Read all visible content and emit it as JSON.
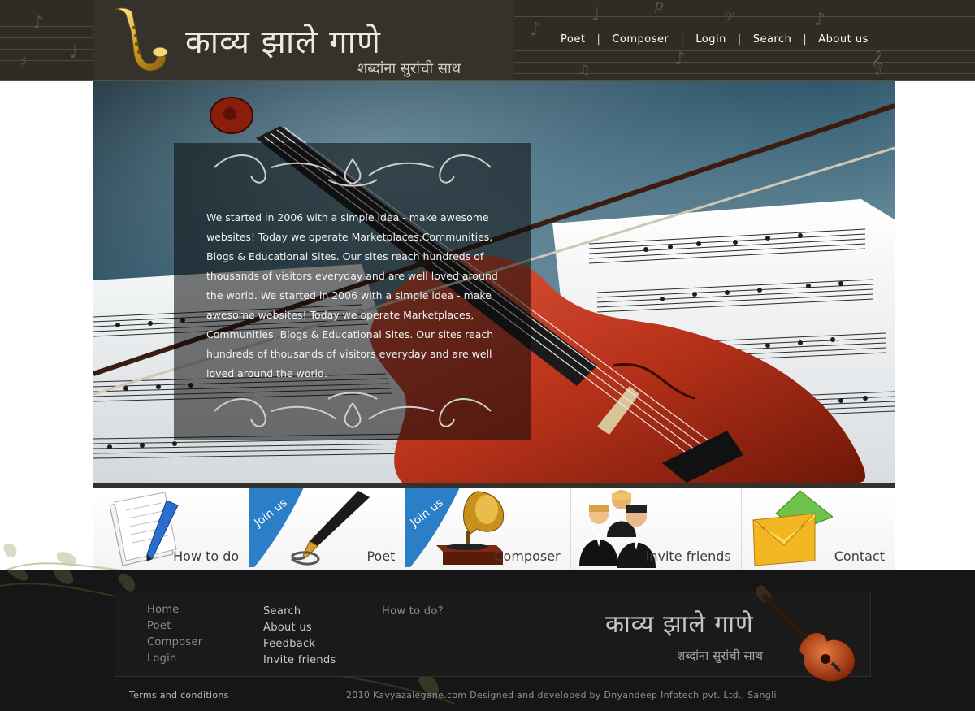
{
  "header": {
    "logo_title": "काव्य झाले गाणे",
    "logo_tagline": "शब्दांना सुरांची साथ",
    "nav": [
      "Poet",
      "Composer",
      "Login",
      "Search",
      "About us"
    ],
    "nav_separator": "|"
  },
  "banner": {
    "text": "We started in 2006 with a simple idea - make awesome websites! Today we operate Marketplaces,Communities, Blogs & Educational Sites.  Our sites reach hundreds of thousands of visitors everyday and are well loved around the world. We started in 2006 with a simple idea - make awesome websites! Today we operate Marketplaces, Communities, Blogs & Educational Sites.  Our sites reach hundreds of thousands of visitors everyday and are well loved around the world."
  },
  "features": {
    "join_badge": "Join us",
    "items": [
      {
        "label": "How to do",
        "icon": "document-pen-icon",
        "join": false
      },
      {
        "label": "Poet",
        "icon": "fountain-pen-icon",
        "join": true
      },
      {
        "label": "Composer",
        "icon": "gramophone-icon",
        "join": true
      },
      {
        "label": "Invite friends",
        "icon": "people-group-icon",
        "join": false
      },
      {
        "label": "Contact",
        "icon": "envelope-icon",
        "join": false
      }
    ]
  },
  "footer": {
    "col1": [
      "Home",
      "Poet",
      "Composer",
      "Login"
    ],
    "col2": [
      "Search",
      "About us",
      "Feedback",
      "Invite friends"
    ],
    "col3": [
      "How to do?"
    ],
    "logo_title": "काव्य झाले गाणे",
    "logo_tagline": "शब्दांना सुरांची साथ",
    "terms": "Terms and conditions",
    "copyright": "2010 Kavyazalegane.com  Designed and developed by Dnyandeep Infotech pvt. Ltd., Sangli."
  },
  "colors": {
    "header_bg": "#2e2c23",
    "footer_bg": "#161616",
    "violin": "#b8321a",
    "footer_link_col1": "#8d8d8d",
    "footer_link_col2": "#c9c9c9",
    "join_badge": "#2a7fc7"
  }
}
